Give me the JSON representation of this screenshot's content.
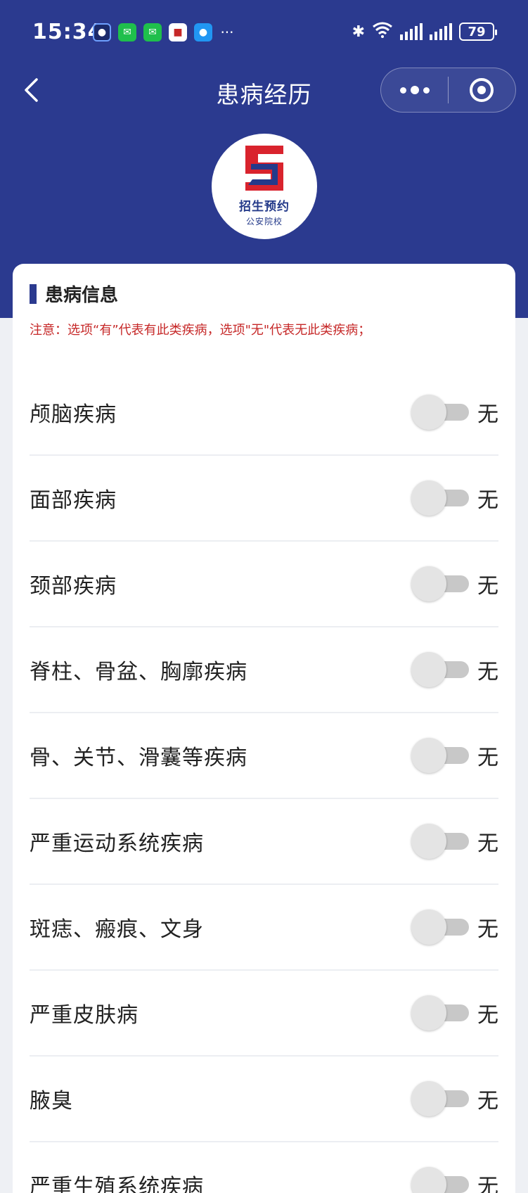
{
  "status_bar": {
    "time": "15:34",
    "battery": "79"
  },
  "nav": {
    "title": "患病经历"
  },
  "logo": {
    "line1": "招生预约",
    "line2": "公安院校"
  },
  "section": {
    "title": "患病信息",
    "notice": "注意：选项“有”代表有此类疾病，选项\"无\"代表无此类疾病；"
  },
  "rows": [
    {
      "label": "颅脑疾病",
      "value": "无"
    },
    {
      "label": "面部疾病",
      "value": "无"
    },
    {
      "label": "颈部疾病",
      "value": "无"
    },
    {
      "label": "脊柱、骨盆、胸廓疾病",
      "value": "无"
    },
    {
      "label": "骨、关节、滑囊等疾病",
      "value": "无"
    },
    {
      "label": "严重运动系统疾病",
      "value": "无"
    },
    {
      "label": "斑痣、瘢痕、文身",
      "value": "无"
    },
    {
      "label": "严重皮肤病",
      "value": "无"
    },
    {
      "label": "腋臭",
      "value": "无"
    },
    {
      "label": "严重生殖系统疾病",
      "value": "无"
    }
  ],
  "colors": {
    "primary": "#2b3a8f",
    "notice": "#c62828"
  }
}
